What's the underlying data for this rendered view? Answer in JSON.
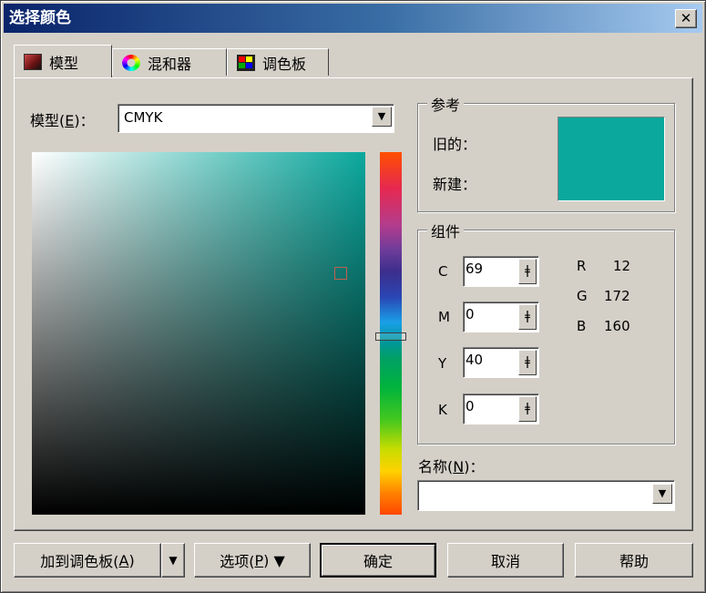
{
  "window": {
    "title": "选择颜色",
    "close_label": "✕"
  },
  "tabs": [
    {
      "label": "模型",
      "icon": "model-icon",
      "active": true
    },
    {
      "label": "混和器",
      "icon": "mixer-icon",
      "active": false
    },
    {
      "label": "调色板",
      "icon": "palette-icon",
      "active": false
    }
  ],
  "model": {
    "label_pre": "模型(",
    "label_key": "E",
    "label_post": ")：",
    "value": "CMYK"
  },
  "reference": {
    "title": "参考",
    "old_label": "旧的：",
    "new_label": "新建：",
    "swatch_color": "#0aa89d"
  },
  "components": {
    "title": "组件",
    "cmyk": [
      {
        "label": "C",
        "value": "69"
      },
      {
        "label": "M",
        "value": "0"
      },
      {
        "label": "Y",
        "value": "40"
      },
      {
        "label": "K",
        "value": "0"
      }
    ],
    "rgb": [
      {
        "label": "R",
        "value": "12"
      },
      {
        "label": "G",
        "value": "172"
      },
      {
        "label": "B",
        "value": "160"
      }
    ]
  },
  "name_field": {
    "label_pre": "名称(",
    "label_key": "N",
    "label_post": ")：",
    "value": ""
  },
  "buttons": {
    "add_palette_pre": "加到调色板(",
    "add_palette_key": "A",
    "add_palette_post": ")",
    "options_pre": "选项(",
    "options_key": "P",
    "options_post": ") ▼",
    "ok": "确定",
    "cancel": "取消",
    "help": "帮助",
    "dropdown_arrow": "▼"
  }
}
